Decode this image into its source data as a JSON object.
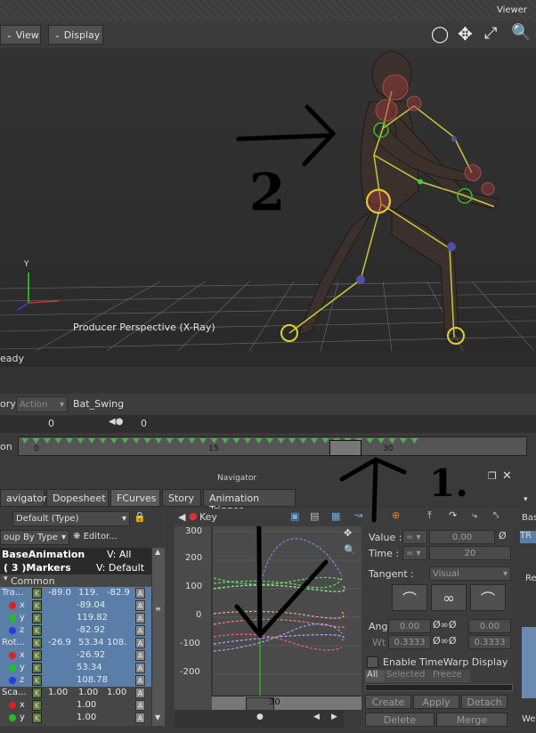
{
  "viewer": {
    "title": "Viewer",
    "menu_view": "View",
    "menu_display": "Display",
    "caption": "Producer Perspective (X-Ray)",
    "axis_y": "Y",
    "annotation_number": "2"
  },
  "status": {
    "text": "eady"
  },
  "action_bar": {
    "left_cut": "ory",
    "action_label": "Action",
    "action_value": "Bat_Swing",
    "frame_start": "0",
    "frame_current": "0"
  },
  "timeline": {
    "label_cut": "on",
    "ticks": [
      "0",
      "15",
      "30"
    ]
  },
  "navigator": {
    "title": "Navigator",
    "tabs": [
      "avigator",
      "Dopesheet",
      "FCurves",
      "Story",
      "Animation Trigger"
    ],
    "annotation_number": "1."
  },
  "left_panel": {
    "type_select": "Default (Type)",
    "group_select": "oup By Type",
    "editor_btn": "Editor...",
    "header_name": "BaseAnimation",
    "header_v": "V: All",
    "markers_name": "( 3 )Markers",
    "markers_v": "V: Default",
    "common": "Common",
    "rows": [
      {
        "label": "Tra...",
        "v1": "-89.0",
        "v2": "119.",
        "v3": "-82.9"
      },
      {
        "label": "x",
        "v1": "-89.04"
      },
      {
        "label": "y",
        "v1": "119.82"
      },
      {
        "label": "z",
        "v1": "-82.92"
      },
      {
        "label": "Rot...",
        "v1": "-26.9",
        "v2": "53.34",
        "v3": "108."
      },
      {
        "label": "x",
        "v1": "-26.92"
      },
      {
        "label": "y",
        "v1": "53.34"
      },
      {
        "label": "z",
        "v1": "108.78"
      },
      {
        "label": "Sca...",
        "v1": "1.00",
        "v2": "1.00",
        "v3": "1.00"
      },
      {
        "label": "x",
        "v1": "1.00"
      },
      {
        "label": "y",
        "v1": "1.00"
      }
    ],
    "k": "K",
    "a": "A"
  },
  "graph": {
    "key_label": "Key",
    "y_ticks": [
      "300",
      "200",
      "100",
      "0",
      "-100",
      "-200"
    ],
    "x_tick": "30"
  },
  "right_panel": {
    "value_label": "Value :",
    "value": "0.00",
    "time_label": "Time :",
    "time": "20",
    "tangent_label": "Tangent :",
    "tangent_value": "Visual",
    "ang_label": "Ang",
    "ang_left": "0.00",
    "ang_right": "0.00",
    "wt_label": "Wt",
    "wt_left": "0.3333",
    "wt_right": "0.3333",
    "timewarp_label": "Enable TimeWarp Display",
    "filter_all": "All",
    "filter_selected": "Selected",
    "filter_freeze": "Freeze",
    "create": "Create",
    "apply": "Apply",
    "detach": "Detach",
    "delete": "Delete",
    "merge": "Merge"
  },
  "far_right": {
    "base": "Bas",
    "tr": "TR",
    "re": "Re",
    "we": "We"
  },
  "colors": {
    "timeline_green": "#4caf50",
    "selected_row": "#5a7ea8",
    "key_green": "#5f7a3a"
  }
}
